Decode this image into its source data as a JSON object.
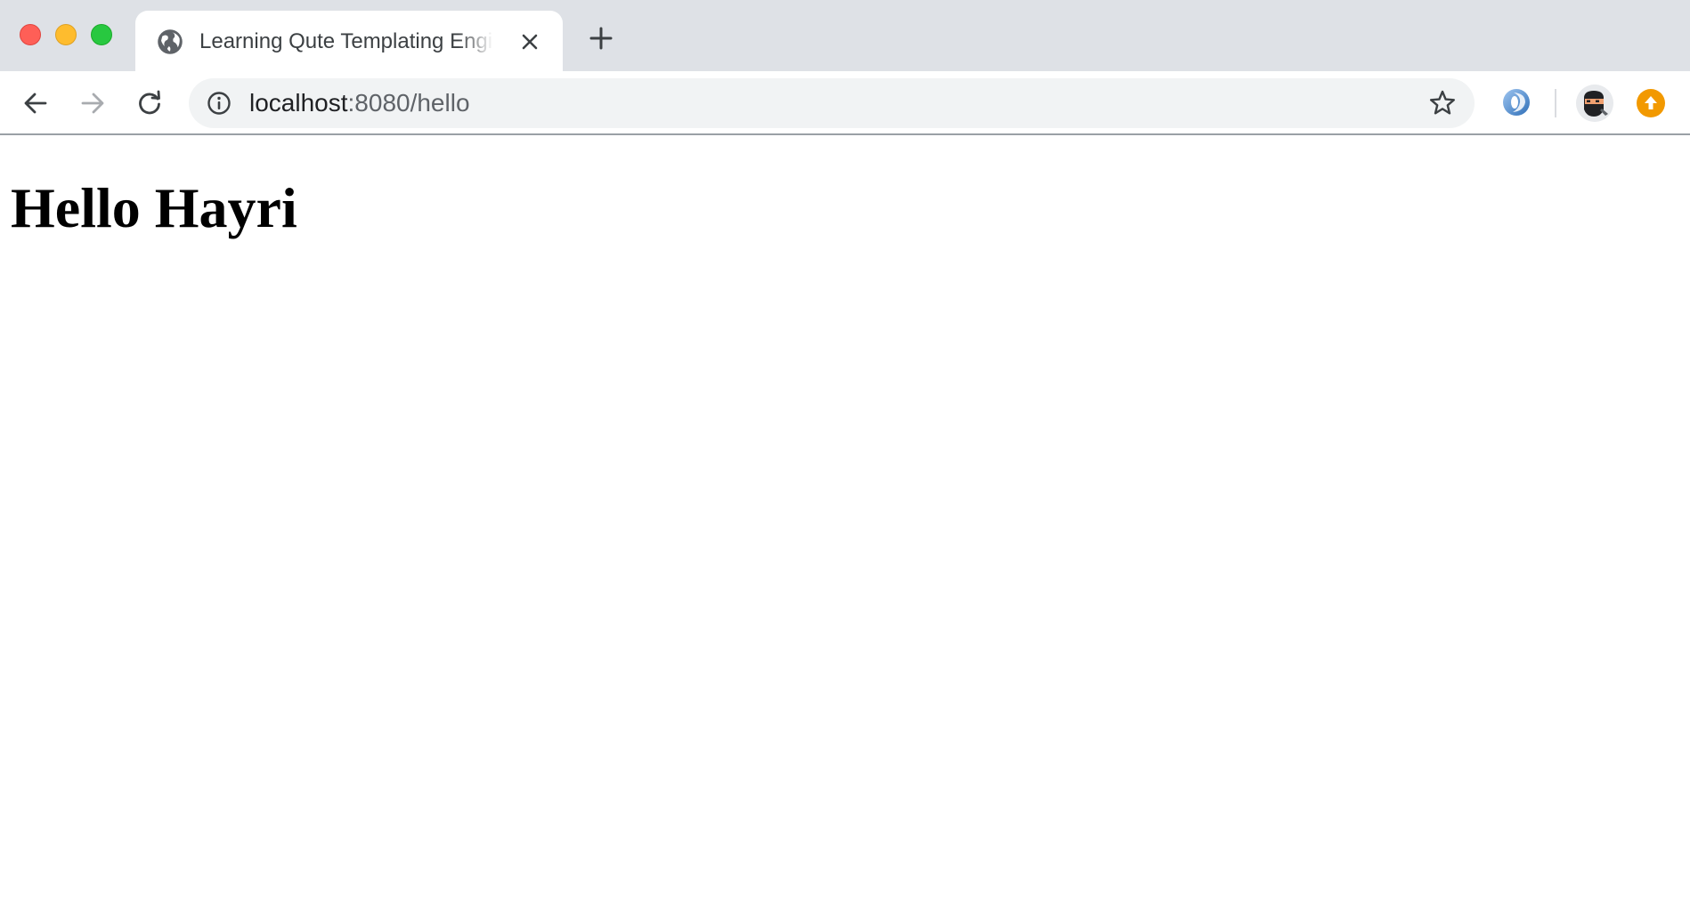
{
  "browser": {
    "tab": {
      "title": "Learning Qute Templating Engine",
      "favicon": "globe-icon",
      "close_icon": "close-icon"
    },
    "new_tab_icon": "plus-icon",
    "toolbar": {
      "back_icon": "arrow-left-icon",
      "forward_icon": "arrow-right-icon",
      "reload_icon": "reload-icon",
      "address": {
        "security_icon": "info-icon",
        "host": "localhost",
        "rest": ":8080/hello"
      },
      "bookmark_icon": "star-icon",
      "extension_icon": "extension-icon",
      "avatar_icon": "ninja-avatar-icon",
      "update_icon": "update-arrow-icon"
    },
    "colors": {
      "tabstrip": "#dee1e6",
      "omnibox": "#f1f3f4",
      "close": "#fe5f57",
      "minimize": "#febc2e",
      "maximize": "#28c840",
      "update": "#f29900"
    }
  },
  "page": {
    "heading": "Hello Hayri"
  }
}
